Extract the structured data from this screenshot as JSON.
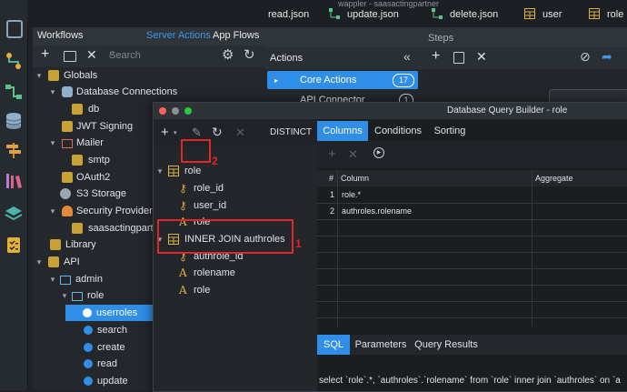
{
  "top_tabs": [
    {
      "label": "read.json"
    },
    {
      "label": "update.json"
    },
    {
      "label": "delete.json"
    },
    {
      "label": "user"
    },
    {
      "label": "role"
    }
  ],
  "top_partial_title": "wappler - saasactingpartner",
  "workflows": {
    "title": "Workflows",
    "tab_server_actions": "Server Actions",
    "tab_app_flows": "App Flows",
    "search_placeholder": "Search",
    "tree": [
      {
        "label": "Globals"
      },
      {
        "label": "Database Connections"
      },
      {
        "label": "db"
      },
      {
        "label": "JWT Signing"
      },
      {
        "label": "Mailer"
      },
      {
        "label": "smtp"
      },
      {
        "label": "OAuth2"
      },
      {
        "label": "S3 Storage"
      },
      {
        "label": "Security Providers"
      },
      {
        "label": "saasactingpartne"
      },
      {
        "label": "Library"
      },
      {
        "label": "API"
      },
      {
        "label": "admin"
      },
      {
        "label": "role"
      },
      {
        "label": "userroles"
      },
      {
        "label": "search"
      },
      {
        "label": "create"
      },
      {
        "label": "read"
      },
      {
        "label": "update"
      }
    ]
  },
  "actions": {
    "title": "Actions",
    "core_actions": "Core Actions",
    "core_count": "17",
    "api_connector": "API Connector",
    "api_count": "1"
  },
  "steps": {
    "title": "Steps"
  },
  "dialog": {
    "title": "Database Query Builder - role",
    "distinct": "DISTINCT",
    "tabs_top": [
      "Columns",
      "Conditions",
      "Sorting"
    ],
    "tabs_bottom": [
      "SQL",
      "Parameters",
      "Query Results"
    ],
    "grid_headers": [
      "#",
      "Column",
      "Aggregate"
    ],
    "grid_rows": [
      {
        "num": "1",
        "column": "role.*"
      },
      {
        "num": "2",
        "column": "authroles.rolename"
      }
    ],
    "tree": [
      {
        "label": "role"
      },
      {
        "label": "role_id"
      },
      {
        "label": "user_id"
      },
      {
        "label": "role"
      },
      {
        "label": "INNER JOIN authroles"
      },
      {
        "label": "authrole_id"
      },
      {
        "label": "rolename"
      },
      {
        "label": "role"
      }
    ],
    "sql_text": "select `role`.*, `authroles`.`rolename` from `role` inner join `authroles` on `a"
  },
  "annotations": {
    "num1": "1",
    "num2": "2",
    "color": "#e0262b"
  },
  "colors": {
    "accent": "#2f8ee8",
    "selected": "#2f8ee8"
  }
}
